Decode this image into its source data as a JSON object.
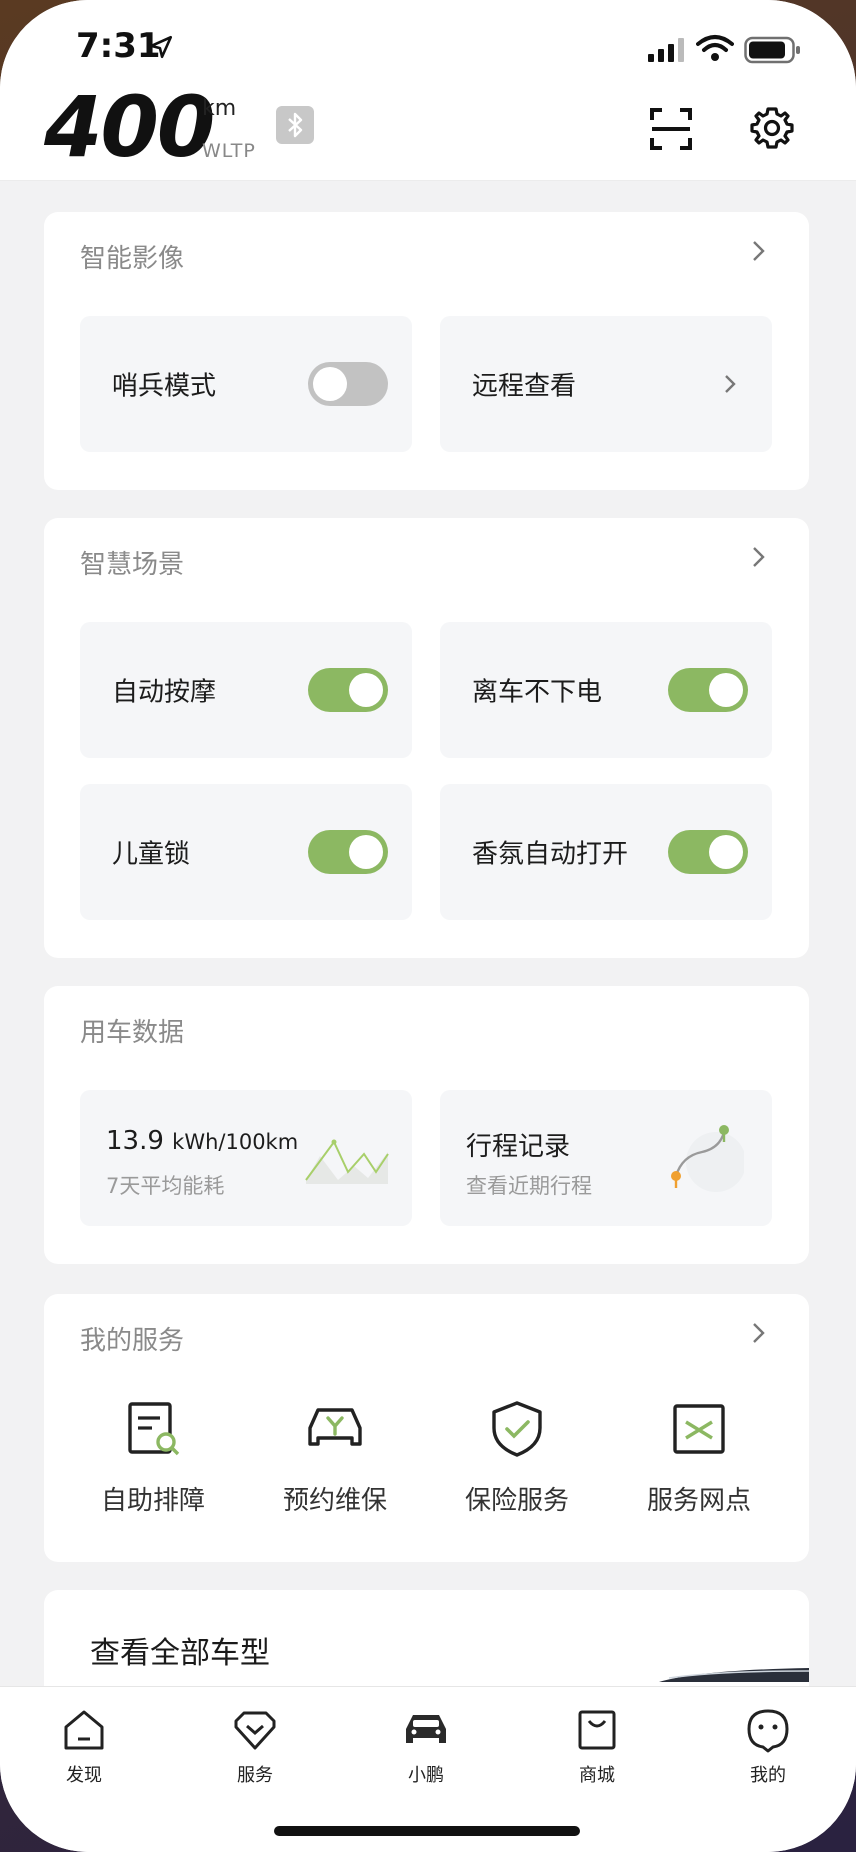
{
  "status": {
    "time": "7:31"
  },
  "header": {
    "range_value": "400",
    "range_unit": "km",
    "range_standard": "WLTP"
  },
  "smart_imaging": {
    "title": "智能影像",
    "tiles": [
      {
        "label": "哨兵模式",
        "control": "toggle",
        "on": false
      },
      {
        "label": "远程查看",
        "control": "chevron"
      }
    ]
  },
  "smart_scenes": {
    "title": "智慧场景",
    "tiles": [
      {
        "label": "自动按摩",
        "on": true
      },
      {
        "label": "离车不下电",
        "on": true
      },
      {
        "label": "儿童锁",
        "on": true
      },
      {
        "label": "香氛自动打开",
        "on": true
      }
    ]
  },
  "usage_data": {
    "title": "用车数据",
    "energy": {
      "value": "13.9",
      "unit": "kWh/100km",
      "caption": "7天平均能耗"
    },
    "trips": {
      "title": "行程记录",
      "caption": "查看近期行程"
    }
  },
  "my_services": {
    "title": "我的服务",
    "items": [
      {
        "label": "自助排障",
        "icon": "troubleshoot-icon"
      },
      {
        "label": "预约维保",
        "icon": "car-wrench-icon"
      },
      {
        "label": "保险服务",
        "icon": "shield-check-icon"
      },
      {
        "label": "服务网点",
        "icon": "service-station-icon"
      }
    ]
  },
  "models": {
    "title": "查看全部车型"
  },
  "tabbar": {
    "items": [
      {
        "label": "发现",
        "icon": "home-icon"
      },
      {
        "label": "服务",
        "icon": "heart-badge-icon"
      },
      {
        "label": "小鹏",
        "icon": "car-icon",
        "active": true
      },
      {
        "label": "商城",
        "icon": "shopping-bag-icon"
      },
      {
        "label": "我的",
        "icon": "profile-face-icon"
      }
    ]
  },
  "colors": {
    "accent": "#8cb862",
    "toggle_off": "#c2c2c2",
    "card": "#ffffff",
    "tile": "#f5f6f8"
  }
}
